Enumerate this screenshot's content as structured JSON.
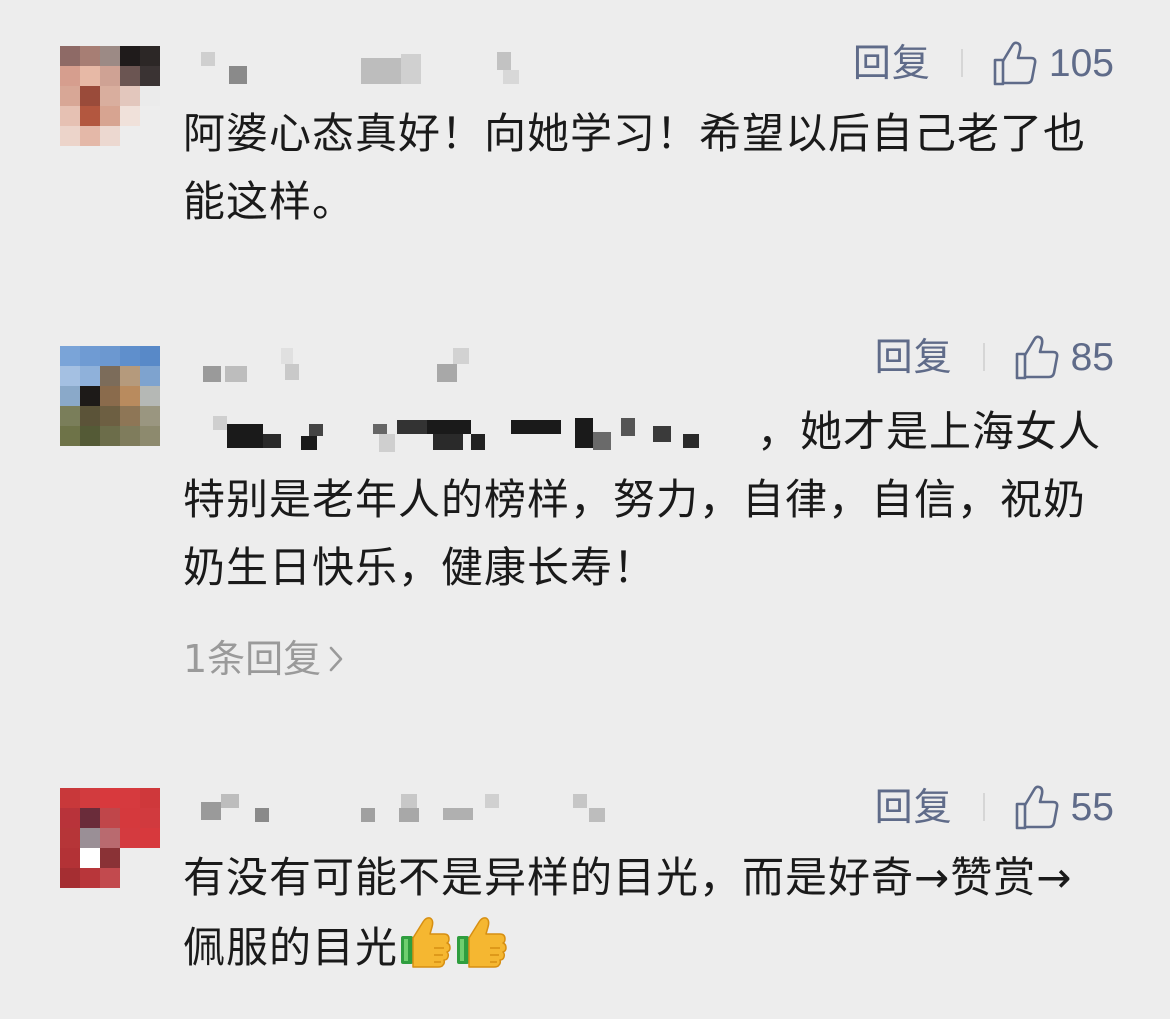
{
  "comments": [
    {
      "reply_label": "回复",
      "like_count": "105",
      "text": "阿婆心态真好！向她学习！希望以后自己老了也能这样。",
      "avatar_icon": "pixelated-avatar-icon",
      "like_icon": "thumbs-up-outline-icon"
    },
    {
      "reply_label": "回复",
      "like_count": "85",
      "text": "，她才是上海女人特别是老年人的榜样，努力，自律，自信，祝奶奶生日快乐，健康长寿！",
      "replies_label": "1条回复",
      "avatar_icon": "pixelated-avatar-icon",
      "like_icon": "thumbs-up-outline-icon"
    },
    {
      "reply_label": "回复",
      "like_count": "55",
      "text": "有没有可能不是异样的目光，而是好奇→赞赏→佩服的目光",
      "emoji_icon": "thumbs-up-emoji-icon",
      "avatar_icon": "pixelated-avatar-icon",
      "like_icon": "thumbs-up-outline-icon"
    }
  ],
  "colors": {
    "background": "#ededed",
    "action_text": "#5f6b89",
    "body_text": "#1a1a1a",
    "muted_text": "#9a9a9a"
  }
}
